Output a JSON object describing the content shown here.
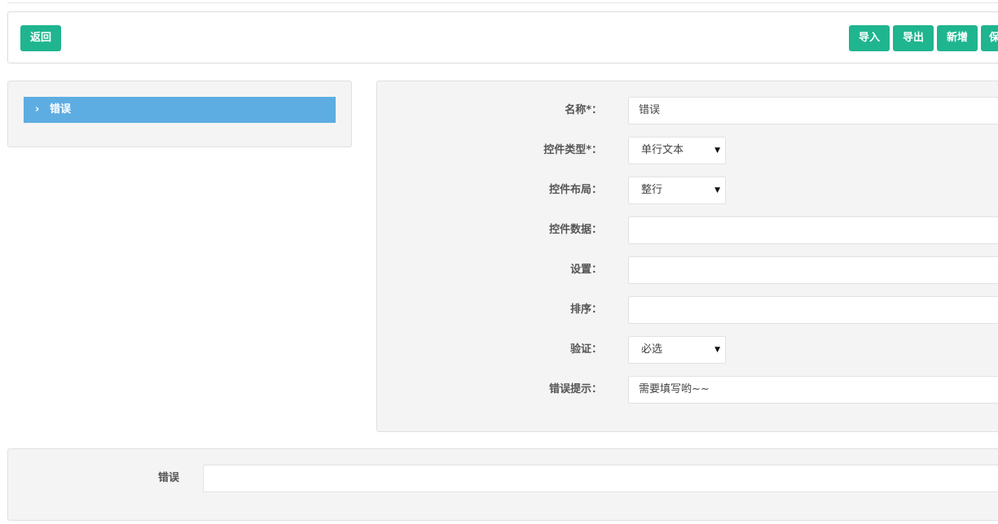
{
  "toolbar": {
    "back_label": "返回",
    "import_label": "导入",
    "export_label": "导出",
    "add_label": "新增",
    "save_label": "保"
  },
  "tree": {
    "items": [
      {
        "label": "错误",
        "icon": "chevron-right-icon"
      }
    ],
    "selected_color": "#5dade2"
  },
  "form": {
    "name_label": "名称*：",
    "name_value": "错误",
    "type_label": "控件类型*：",
    "type_value": "单行文本",
    "layout_label": "控件布局：",
    "layout_value": "整行",
    "data_label": "控件数据：",
    "data_value": "",
    "settings_label": "设置：",
    "settings_value": "",
    "sort_label": "排序：",
    "sort_value": "",
    "validate_label": "验证：",
    "validate_value": "必选",
    "error_label": "错误提示：",
    "error_value": "需要填写哟~~"
  },
  "preview": {
    "label": "错误",
    "value": ""
  },
  "colors": {
    "accent": "#1fb58f",
    "panel_bg": "#f4f4f4"
  }
}
